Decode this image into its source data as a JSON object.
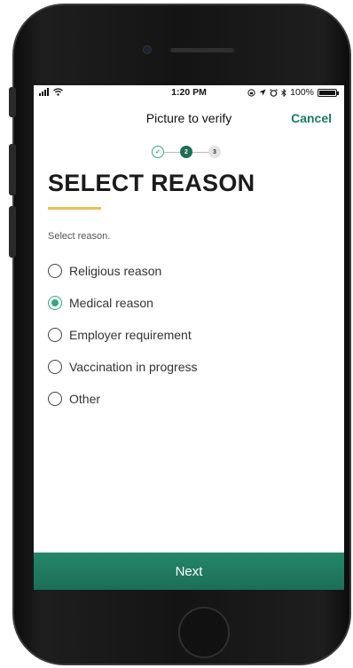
{
  "status_bar": {
    "time": "1:20 PM",
    "battery": "100%",
    "battery_level": 1.0,
    "icons": [
      "signal-icon",
      "wifi-icon",
      "screen-lock-icon",
      "location-icon",
      "alarm-icon",
      "bluetooth-icon",
      "battery-icon"
    ]
  },
  "nav": {
    "title": "Picture to verify",
    "cancel_label": "Cancel"
  },
  "stepper": {
    "steps": [
      {
        "label": "✓",
        "state": "done"
      },
      {
        "label": "2",
        "state": "active"
      },
      {
        "label": "3",
        "state": "upcoming"
      }
    ]
  },
  "page": {
    "heading": "SELECT REASON",
    "prompt": "Select reason."
  },
  "options": [
    {
      "label": "Religious reason",
      "selected": false
    },
    {
      "label": "Medical reason",
      "selected": true
    },
    {
      "label": "Employer requirement",
      "selected": false
    },
    {
      "label": "Vaccination in progress",
      "selected": false
    },
    {
      "label": "Other",
      "selected": false
    }
  ],
  "footer": {
    "next_label": "Next"
  },
  "colors": {
    "accent": "#1c7a5f",
    "radio_selected": "#35a87d",
    "underline": "#ecc04f"
  }
}
